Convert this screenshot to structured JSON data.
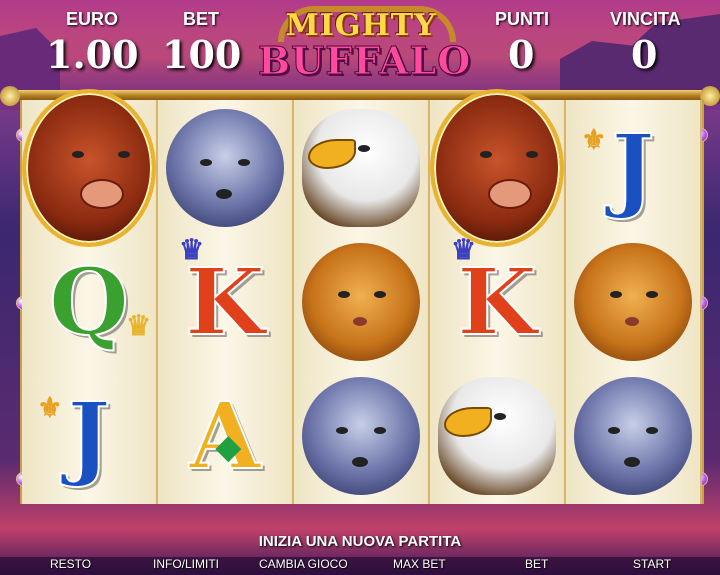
{
  "header": {
    "euro_label": "EURO",
    "euro_value": "1.00",
    "bet_label": "BET",
    "bet_value": "100",
    "punti_label": "PUNTI",
    "punti_value": "0",
    "vincita_label": "VINCITA",
    "vincita_value": "0"
  },
  "logo": {
    "line1": "MIGHTY",
    "line2": "BUFFALO"
  },
  "reels": [
    [
      "buffalo",
      "Q",
      "J"
    ],
    [
      "wolf",
      "K",
      "A"
    ],
    [
      "eagle",
      "puma",
      "wolf"
    ],
    [
      "buffalo",
      "K",
      "eagle"
    ],
    [
      "J",
      "puma",
      "wolf"
    ]
  ],
  "symbols": {
    "q": "Q",
    "k": "K",
    "j": "J",
    "a": "A"
  },
  "status": "INIZIA UNA NUOVA PARTITA",
  "footer": {
    "resto": "RESTO",
    "info": "INFO/LIMITI",
    "cambia": "CAMBIA GIOCO",
    "maxbet": "MAX BET",
    "bet": "BET",
    "start": "START"
  },
  "colors": {
    "q": "#3aa030",
    "k": "#e0401a",
    "j": "#1a50c0",
    "a": "#f0b020",
    "frame": "#c9a04a"
  }
}
